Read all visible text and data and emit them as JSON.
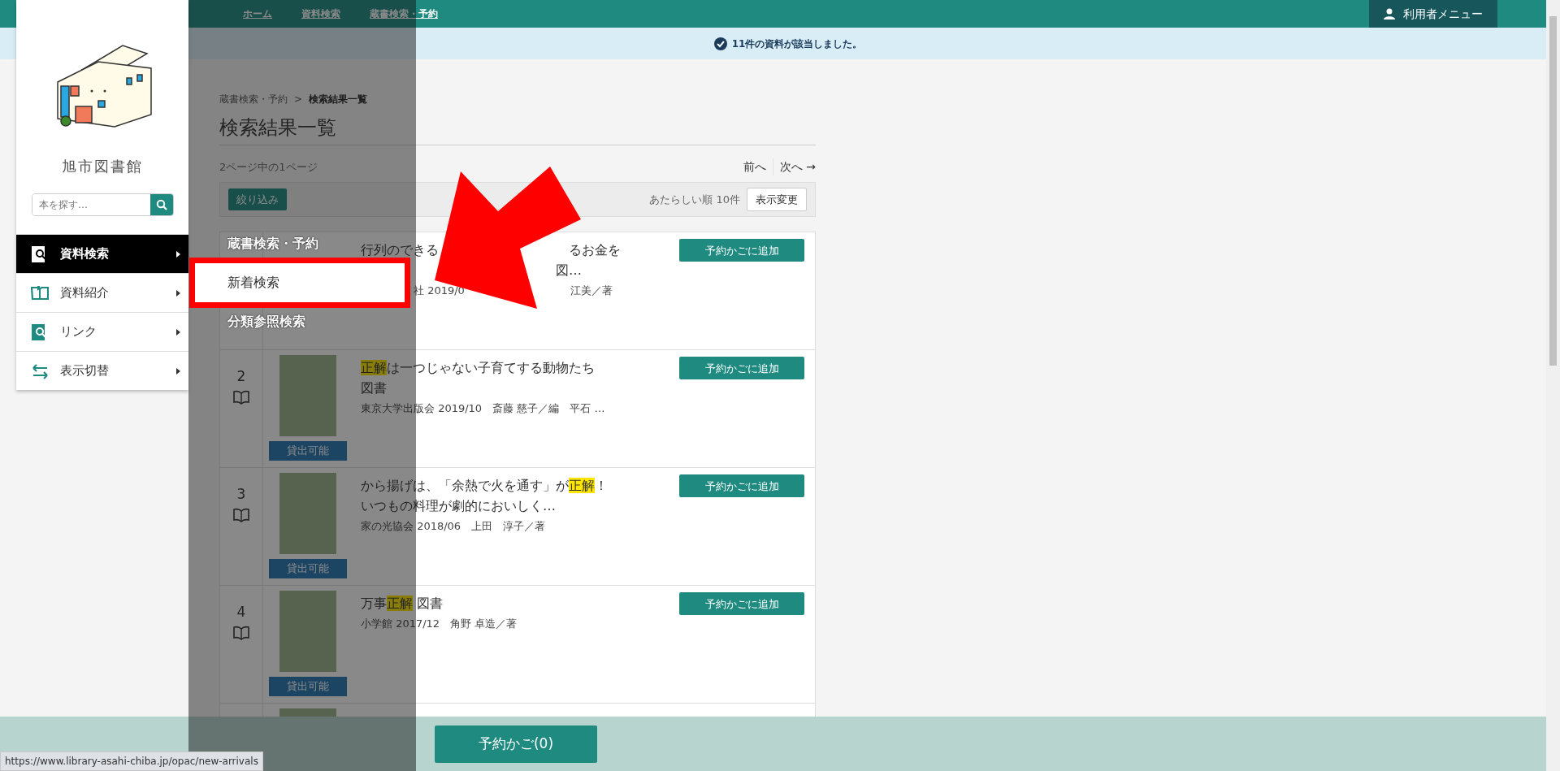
{
  "top_bar": {
    "breadcrumbs": [
      "ホーム",
      "資料検索",
      "蔵書検索・予約"
    ],
    "user_menu": "利用者メニュー"
  },
  "alert": {
    "message": "11件の資料が該当しました。"
  },
  "page": {
    "breadcrumbs": [
      {
        "label": "蔵書検索・予約",
        "current": false
      },
      {
        "label": "検索結果一覧",
        "current": true
      }
    ],
    "separator": ">",
    "title": "検索結果一覧",
    "page_info": "2ページ中の1ページ",
    "prev": "前へ",
    "next": "次へ →",
    "filter_button": "絞り込み",
    "sort_info": "あたらしい順 10件",
    "view_button": "表示変更"
  },
  "results": [
    {
      "kind": "covered",
      "title_lines": [
        [
          {
            "kind": "text",
            "text": "行列のできる"
          },
          {
            "kind": "hidden"
          },
          {
            "kind": "hidden"
          },
          {
            "kind": "text",
            "text": "るお金を"
          }
        ],
        [
          {
            "kind": "hidden"
          },
          {
            "kind": "hidden"
          },
          {
            "kind": "hidden"
          },
          {
            "kind": "text",
            "text": "図…"
          }
        ]
      ],
      "meta": [
        {
          "kind": "hidden"
        },
        {
          "kind": "text",
          "text": "社 2019/0"
        },
        {
          "kind": "hidden"
        },
        {
          "kind": "hidden"
        },
        {
          "kind": "text",
          "text": "江美／著"
        }
      ],
      "button": "予約かごに追加"
    },
    {
      "kind": "full",
      "number": "2",
      "status": "貸出可能",
      "title_lines": [
        [
          {
            "kind": "mark",
            "text": "正解"
          },
          {
            "kind": "text",
            "text": "は一つじゃない子育てする動物たち"
          }
        ],
        [
          {
            "kind": "text",
            "text": "図書"
          }
        ]
      ],
      "meta": [
        {
          "kind": "text",
          "text": "東京大学出版会 2019/10　斎藤 慈子／編　平石 …"
        }
      ],
      "button": "予約かごに追加"
    },
    {
      "kind": "full",
      "number": "3",
      "status": "貸出可能",
      "title_lines": [
        [
          {
            "kind": "text",
            "text": "から揚げは、「余熱で火を通す」が"
          },
          {
            "kind": "mark",
            "text": "正解"
          },
          {
            "kind": "text",
            "text": "！"
          }
        ],
        [
          {
            "kind": "text",
            "text": "いつもの料理が劇的においしく…"
          }
        ]
      ],
      "meta": [
        {
          "kind": "text",
          "text": "家の光協会 2018/06　上田　淳子／著"
        }
      ],
      "button": "予約かごに追加"
    },
    {
      "kind": "full",
      "number": "4",
      "status": "貸出可能",
      "title_lines": [
        [
          {
            "kind": "text",
            "text": "万事"
          },
          {
            "kind": "mark",
            "text": "正解"
          },
          {
            "kind": "text",
            "text": " 図書"
          }
        ]
      ],
      "meta": [
        {
          "kind": "text",
          "text": "小学館 2017/12　角野 卓造／著"
        }
      ],
      "button": "予約かごに追加"
    },
    {
      "kind": "cut"
    }
  ],
  "cart_button": "予約かご(0)",
  "sidebar": {
    "library_name": "旭市図書館",
    "search_placeholder": "本を探す…",
    "items": [
      {
        "label": "資料検索",
        "selected": true
      },
      {
        "label": "資料紹介",
        "selected": false
      },
      {
        "label": "リンク",
        "selected": false
      },
      {
        "label": "表示切替",
        "selected": false
      }
    ]
  },
  "submenu": {
    "items": [
      {
        "label": "蔵書検索・予約",
        "highlighted": false
      },
      {
        "label": "新着検索",
        "highlighted": true
      },
      {
        "label": "分類参照検索",
        "highlighted": false
      }
    ]
  },
  "status_url": "https://www.library-asahi-chiba.jp/opac/new-arrivals"
}
